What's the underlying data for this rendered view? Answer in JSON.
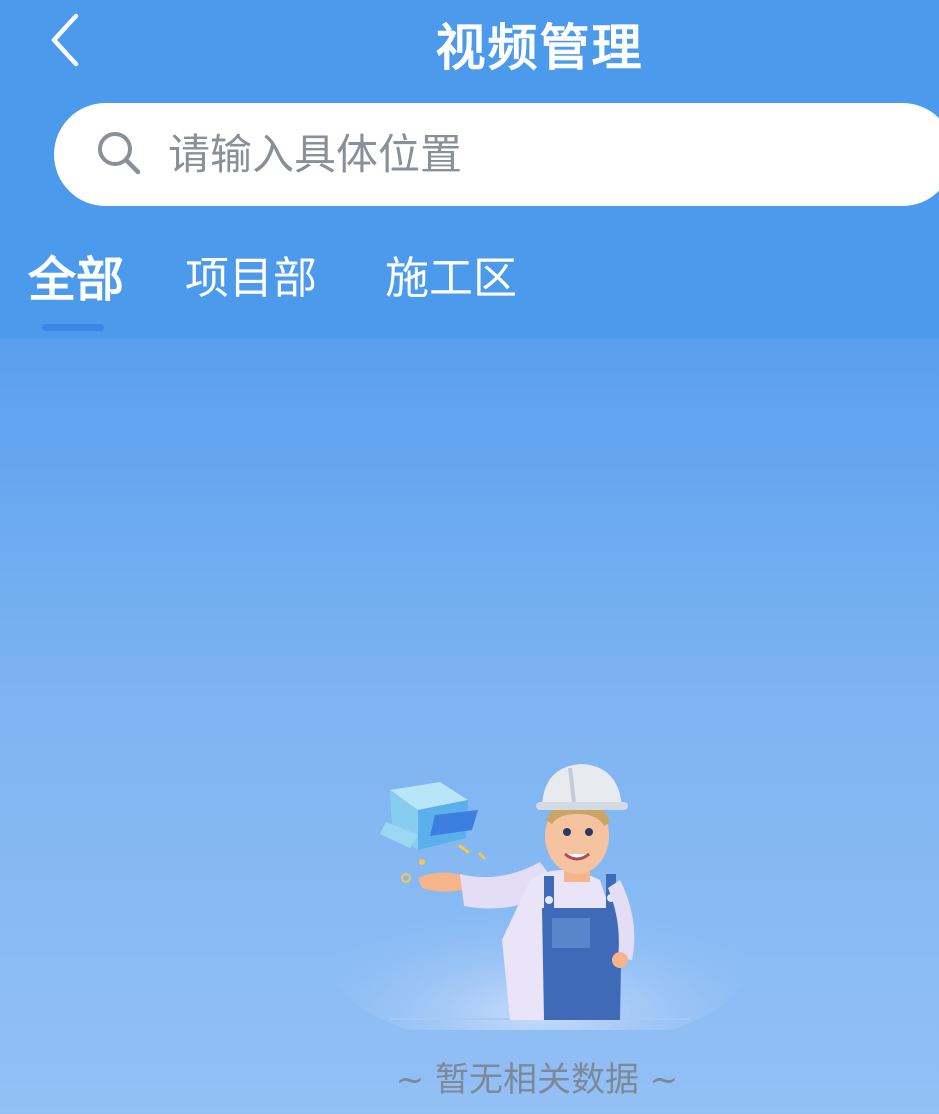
{
  "header": {
    "title": "视频管理",
    "back_icon": "chevron-left-icon"
  },
  "search": {
    "placeholder": "请输入具体位置",
    "icon": "search-icon"
  },
  "tabs": [
    {
      "label": "全部",
      "active": true
    },
    {
      "label": "项目部",
      "active": false
    },
    {
      "label": "施工区",
      "active": false
    }
  ],
  "empty_state": {
    "message": "~ 暂无相关数据 ~",
    "illustration": "worker-with-box-illustration"
  },
  "colors": {
    "primary": "#4b9aec",
    "tab_indicator": "#3c86e8",
    "placeholder_text": "#8a8f99",
    "empty_text": "#7e8896"
  }
}
